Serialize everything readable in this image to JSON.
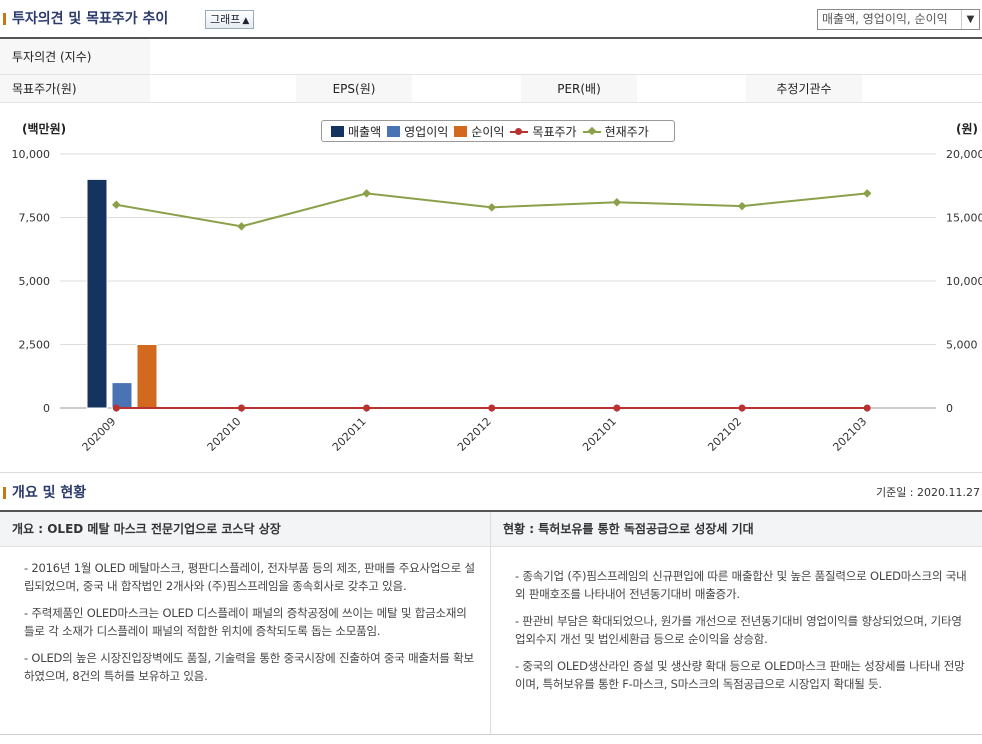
{
  "section1": {
    "title": "투자의견 및 목표주가 추이",
    "toggle_label": "그래프",
    "toggle_icon": "caret-up-icon"
  },
  "dropdown": {
    "selected": "매출액, 영업이익, 순이익"
  },
  "opinion_table": {
    "row1": {
      "label": "투자의견 (지수)"
    },
    "row2": {
      "label": "목표주가(원)",
      "eps_label": "EPS(원)",
      "per_label": "PER(배)",
      "analysts_label": "추정기관수"
    }
  },
  "chart_data": {
    "type": "bar",
    "categories": [
      "202009",
      "202010",
      "202011",
      "202012",
      "202101",
      "202102",
      "202103"
    ],
    "y_left": {
      "unit": "(백만원)",
      "ylim": [
        0,
        10000
      ],
      "ticks": [
        "10,000",
        "7,500",
        "5,000",
        "2,500",
        "0"
      ]
    },
    "y_right": {
      "unit": "(원)",
      "ylim": [
        0,
        20000
      ],
      "ticks": [
        "20,000",
        "15,000",
        "10,000",
        "5,000",
        "0"
      ]
    },
    "series": [
      {
        "name": "매출액",
        "kind": "bar",
        "axis": "left",
        "color": "#14335e",
        "values": [
          9000,
          null,
          null,
          null,
          null,
          null,
          null
        ]
      },
      {
        "name": "영업이익",
        "kind": "bar",
        "axis": "left",
        "color": "#4a73b3",
        "values": [
          1000,
          null,
          null,
          null,
          null,
          null,
          null
        ]
      },
      {
        "name": "순이익",
        "kind": "bar",
        "axis": "left",
        "color": "#d2691e",
        "values": [
          2500,
          null,
          null,
          null,
          null,
          null,
          null
        ]
      },
      {
        "name": "목표주가",
        "kind": "line",
        "axis": "right",
        "color": "#b83232",
        "values": [
          0,
          0,
          0,
          0,
          0,
          0,
          0
        ]
      },
      {
        "name": "현재주가",
        "kind": "line",
        "axis": "right",
        "color": "#8aa14a",
        "values": [
          16000,
          14300,
          16900,
          15800,
          16200,
          15900,
          16900
        ]
      }
    ],
    "grid": true,
    "legend": "top-center"
  },
  "section2": {
    "title": "개요 및 현황",
    "base_date": "기준일 : 2020.11.27"
  },
  "overview": {
    "left_title": "개요 : OLED 메탈 마스크 전문기업으로 코스닥 상장",
    "left_items": [
      "- 2016년 1월 OLED 메탈마스크, 평판디스플레이, 전자부품 등의 제조, 판매를 주요사업으로 설립되었으며, 중국 내 합작법인 2개사와 (주)핌스프레임을 종속회사로 갖추고 있음.",
      "- 주력제품인 OLED마스크는 OLED 디스플레이 패널의 증착공정에 쓰이는 메탈 및 합금소재의 틀로 각 소재가 디스플레이 패널의 적합한 위치에 증착되도록 돕는 소모품임.",
      "- OLED의 높은 시장진입장벽에도 품질, 기술력을 통한 중국시장에 진출하여 중국 매출처를 확보하였으며, 8건의 특허를 보유하고 있음."
    ],
    "right_title": "현황 : 특허보유를 통한 독점공급으로 성장세 기대",
    "right_items": [
      "- 종속기업 (주)핌스프레임의 신규편입에 따른 매출합산 및 높은 품질력으로 OLED마스크의 국내외 판매호조를 나타내어 전년동기대비 매출증가.",
      "- 판관비 부담은 확대되었으나, 원가를 개선으로 전년동기대비 영업이익를 향상되었으며, 기타영업외수지 개선 및 법인세환급 등으로 순이익을 상승함.",
      "- 중국의 OLED생산라인 증설 및 생산량 확대 등으로 OLED마스크 판매는 성장세를 나타내 전망이며, 특허보유를 통한 F-마스크, S마스크의 독점공급으로 시장입지 확대될 듯."
    ]
  }
}
